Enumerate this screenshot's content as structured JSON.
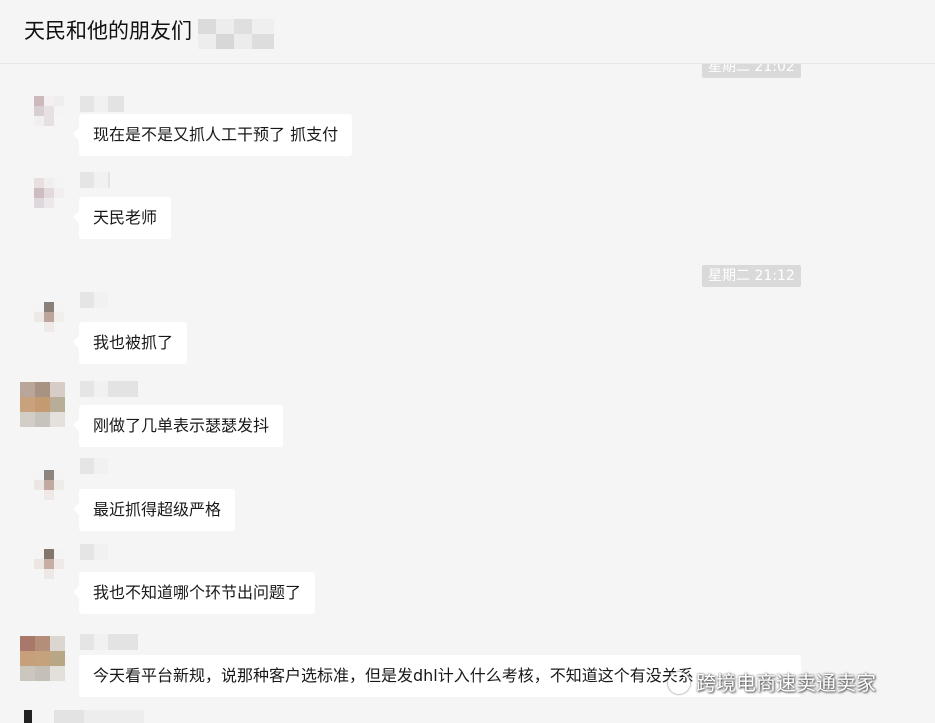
{
  "header": {
    "title": "天民和他的朋友们"
  },
  "timestamps": [
    "星期二 21:02",
    "星期二 21:12"
  ],
  "messages": [
    {
      "text": "现在是不是又抓人工干预了    抓支付"
    },
    {
      "text": "天民老师"
    },
    {
      "text": "我也被抓了"
    },
    {
      "text": "刚做了几单表示瑟瑟发抖"
    },
    {
      "text": "最近抓得超级严格"
    },
    {
      "text": "我也不知道哪个环节出问题了"
    },
    {
      "text": "今天看平台新规，说那种客户选标准，但是发dhl计入什么考核，不知道这个有没关系"
    }
  ],
  "watermark": {
    "text": "跨境电商速卖通卖家",
    "icon": "wechat-icon"
  },
  "colors": {
    "background": "#f5f5f5",
    "bubble": "#ffffff",
    "timestamp": "#dadada"
  }
}
